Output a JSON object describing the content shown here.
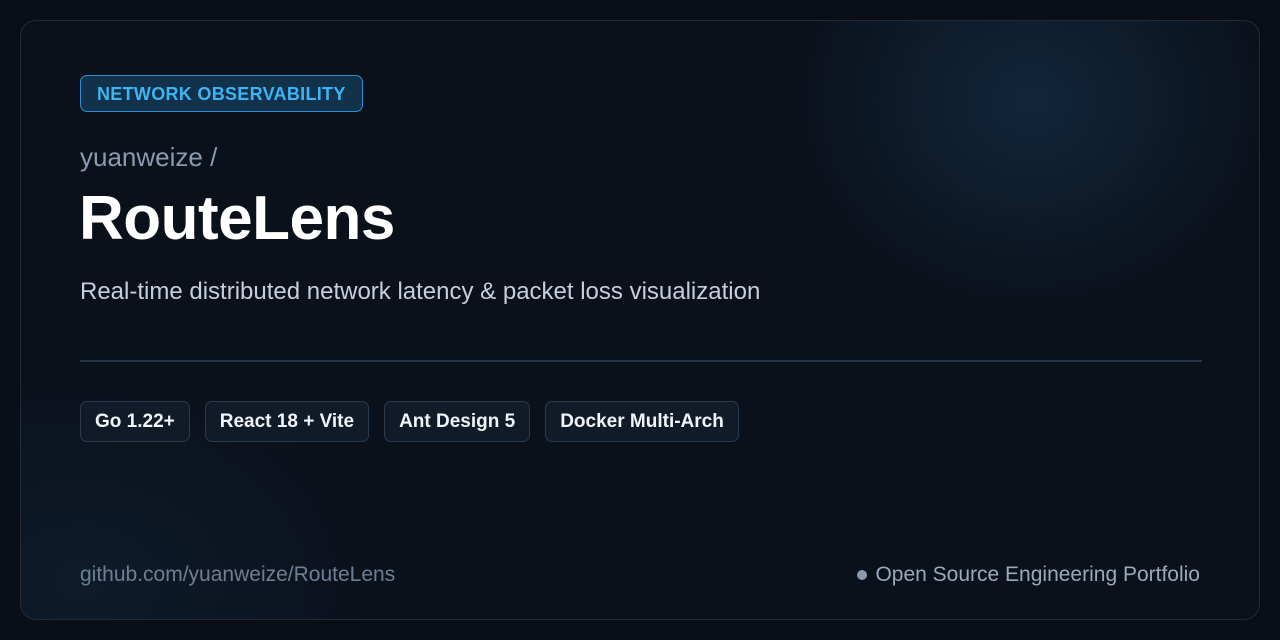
{
  "badge": {
    "label": "NETWORK OBSERVABILITY"
  },
  "repo": {
    "owner": "yuanweize /",
    "name": "RouteLens",
    "description": "Real-time distributed network latency & packet loss visualization"
  },
  "tags": [
    {
      "label": "Go 1.22+"
    },
    {
      "label": "React 18 + Vite"
    },
    {
      "label": "Ant Design 5"
    },
    {
      "label": "Docker Multi-Arch"
    }
  ],
  "footer": {
    "url": "github.com/yuanweize/RouteLens",
    "portfolio": "Open Source Engineering Portfolio",
    "dot_icon": "bullet-dot-icon"
  },
  "colors": {
    "background": "#0a0f17",
    "card": "#0b111b",
    "accent": "#3fb4f3",
    "text_primary": "#ffffff",
    "text_muted": "#8a9bb0"
  }
}
